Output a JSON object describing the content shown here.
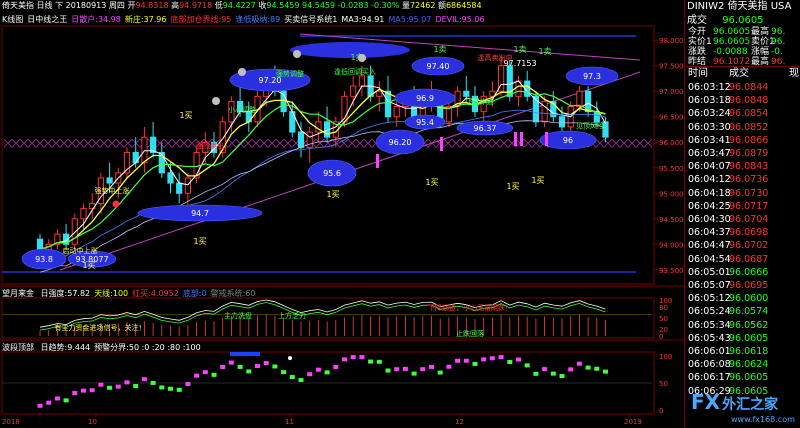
{
  "header": {
    "name": "倚天美指",
    "period": "日线",
    "direction": "下",
    "date": "20180913",
    "weekday": "周四",
    "open_label": "开",
    "open": "94.8318",
    "high_label": "高",
    "high": "94.9718",
    "low_label": "低",
    "low": "94.4227",
    "close_label": "收",
    "close": "94.5459",
    "ref": "94.5459",
    "change": "-0.0283",
    "pct": "-0.30%",
    "vol_label": "量",
    "vol": "72462",
    "amt_label": "额",
    "amt": "6864584"
  },
  "indicator_line": {
    "items": [
      {
        "text": "K线图",
        "color": "#ffffff"
      },
      {
        "text": "日中线之王",
        "color": "#ffffff"
      },
      {
        "text": "日散户:34.98",
        "color": "#ff40ff"
      },
      {
        "text": "新庄:37.96",
        "color": "#ffff00"
      },
      {
        "text": "底部加仓界线:95",
        "color": "#ff3030"
      },
      {
        "text": "逢低吸纳:89",
        "color": "#4080ff"
      },
      {
        "text": "买卖信号系统1",
        "color": "#ffffff"
      },
      {
        "text": "MA3:94.91",
        "color": "#ffffff"
      },
      {
        "text": "MA5:95.07",
        "color": "#4060ff"
      },
      {
        "text": "DEVIL:95.06",
        "color": "#ff40ff"
      }
    ]
  },
  "main_axis": {
    "labels": [
      "98.000",
      "97.500",
      "97.000",
      "96.500",
      "96.000",
      "95.500",
      "95.000",
      "94.500",
      "94.000",
      "93.500"
    ],
    "min": 93.3,
    "max": 98.2
  },
  "annotations": {
    "ovals": [
      "97.20",
      "97.40",
      "97.3",
      "96.9",
      "95.4",
      "96.37",
      "96.20",
      "96",
      "95.6",
      "94.7",
      "93.8",
      "93.8077"
    ],
    "peak": "97.7153",
    "buy_marks": [
      "1买",
      "1买",
      "1买",
      "1买",
      "1买",
      "1买",
      "1买"
    ],
    "sell_marks": [
      "1卖",
      "1卖",
      "1卖",
      "1卖"
    ],
    "texts": [
      "下降中途",
      "强势中上涨",
      "启动中上涨",
      "小心调整",
      "强势调整",
      "强烈卖出",
      "见顶风险",
      "逢低回调买入",
      "逢高卖出中"
    ]
  },
  "panel2": {
    "title": "望月来金",
    "items": [
      {
        "text": "日强度:57.82",
        "color": "#ffffff"
      },
      {
        "text": "天线:100",
        "color": "#ffff00"
      },
      {
        "text": "红买:4.0952",
        "color": "#ff3030"
      },
      {
        "text": "底部:0",
        "color": "#4080ff"
      },
      {
        "text": "警戒系统:60",
        "color": "#808080"
      }
    ],
    "axis": [
      "100",
      "80",
      "50",
      "20",
      "0"
    ],
    "texts": [
      "下降通道，小心无量阴跌！",
      "主力洗盘",
      "上方乏力",
      "有主力资金进场信号，关注！",
      "止跌回落"
    ]
  },
  "panel3": {
    "title": "波段顶部",
    "items": [
      {
        "text": "日趋势:9.444",
        "color": "#ffffff"
      },
      {
        "text": "预警分界:50 :0 :20 :80 :100",
        "color": "#ffffff"
      }
    ],
    "axis": [
      "100",
      "50",
      "0"
    ]
  },
  "x_axis": {
    "labels": [
      "2018",
      "10",
      "11",
      "12",
      "2019"
    ]
  },
  "chart_data": {
    "type": "candlestick",
    "candles": [
      [
        94.1,
        94.2,
        93.7,
        93.9
      ],
      [
        93.9,
        94.1,
        93.6,
        94.0
      ],
      [
        94.0,
        94.3,
        93.9,
        94.2
      ],
      [
        94.2,
        94.4,
        93.9,
        94.0
      ],
      [
        94.0,
        94.6,
        93.9,
        94.5
      ],
      [
        94.5,
        94.8,
        94.3,
        94.7
      ],
      [
        94.7,
        95.0,
        94.5,
        94.8
      ],
      [
        94.8,
        95.4,
        94.6,
        95.3
      ],
      [
        95.3,
        95.6,
        95.0,
        95.2
      ],
      [
        95.2,
        95.5,
        94.9,
        95.4
      ],
      [
        95.4,
        95.9,
        95.3,
        95.8
      ],
      [
        95.8,
        96.1,
        95.5,
        95.6
      ],
      [
        95.6,
        96.3,
        95.4,
        96.1
      ],
      [
        96.1,
        96.4,
        95.7,
        95.8
      ],
      [
        95.8,
        96.0,
        95.3,
        95.4
      ],
      [
        95.4,
        95.6,
        95.0,
        95.2
      ],
      [
        95.2,
        95.4,
        94.8,
        95.0
      ],
      [
        95.0,
        95.4,
        94.7,
        95.3
      ],
      [
        95.3,
        95.9,
        95.2,
        95.8
      ],
      [
        95.8,
        96.2,
        95.6,
        96.0
      ],
      [
        96.0,
        96.2,
        95.7,
        95.8
      ],
      [
        95.8,
        96.5,
        95.7,
        96.4
      ],
      [
        96.4,
        96.9,
        96.2,
        96.8
      ],
      [
        96.8,
        97.1,
        96.5,
        96.6
      ],
      [
        96.6,
        96.8,
        96.2,
        96.4
      ],
      [
        96.4,
        97.0,
        96.3,
        96.9
      ],
      [
        96.9,
        97.4,
        96.7,
        97.2
      ],
      [
        97.2,
        97.5,
        96.9,
        97.0
      ],
      [
        97.0,
        97.2,
        96.5,
        96.6
      ],
      [
        96.6,
        96.8,
        96.1,
        96.2
      ],
      [
        96.2,
        96.4,
        95.7,
        95.9
      ],
      [
        95.9,
        96.3,
        95.6,
        96.2
      ],
      [
        96.2,
        96.6,
        96.0,
        96.4
      ],
      [
        96.4,
        96.7,
        96.0,
        96.1
      ],
      [
        96.1,
        96.5,
        95.9,
        96.4
      ],
      [
        96.4,
        97.0,
        96.3,
        96.9
      ],
      [
        96.9,
        97.3,
        96.7,
        97.1
      ],
      [
        97.1,
        97.5,
        96.9,
        97.3
      ],
      [
        97.3,
        97.5,
        96.8,
        96.9
      ],
      [
        96.9,
        97.2,
        96.6,
        97.0
      ],
      [
        97.0,
        97.3,
        96.4,
        96.5
      ],
      [
        96.5,
        96.8,
        96.3,
        96.7
      ],
      [
        96.7,
        97.0,
        96.5,
        96.8
      ],
      [
        96.8,
        97.1,
        96.4,
        96.5
      ],
      [
        96.5,
        96.9,
        96.3,
        96.8
      ],
      [
        96.8,
        97.2,
        96.6,
        96.9
      ],
      [
        96.9,
        97.0,
        96.3,
        96.4
      ],
      [
        96.4,
        96.8,
        96.3,
        96.7
      ],
      [
        96.7,
        97.1,
        96.5,
        97.0
      ],
      [
        97.0,
        97.3,
        96.8,
        96.9
      ],
      [
        96.9,
        97.1,
        96.5,
        96.6
      ],
      [
        96.6,
        97.0,
        96.4,
        96.9
      ],
      [
        96.9,
        97.2,
        96.7,
        97.0
      ],
      [
        97.0,
        97.7,
        96.9,
        97.5
      ],
      [
        97.5,
        97.6,
        96.8,
        96.9
      ],
      [
        96.9,
        97.3,
        96.7,
        97.2
      ],
      [
        97.2,
        97.4,
        96.8,
        96.9
      ],
      [
        96.9,
        97.0,
        96.3,
        96.4
      ],
      [
        96.4,
        96.9,
        96.3,
        96.8
      ],
      [
        96.8,
        97.0,
        96.4,
        96.5
      ],
      [
        96.5,
        96.7,
        96.1,
        96.3
      ],
      [
        96.3,
        96.8,
        96.2,
        96.7
      ],
      [
        96.7,
        97.1,
        96.6,
        97.0
      ],
      [
        97.0,
        97.1,
        96.5,
        96.6
      ],
      [
        96.6,
        96.8,
        96.3,
        96.4
      ],
      [
        96.4,
        96.5,
        96.0,
        96.1
      ]
    ]
  },
  "right": {
    "title": "成交",
    "title_price": "96.0605",
    "quote": [
      {
        "k": "今开",
        "v": "96.0605",
        "k2": "最高",
        "v2": "96.",
        "c": "g"
      },
      {
        "k": "实价1",
        "v": "96.0605",
        "k2": "卖价1",
        "v2": "96.",
        "c": "g"
      },
      {
        "k": "涨跌",
        "v": "-0.0088",
        "k2": "涨幅",
        "v2": "-0.",
        "c": "g"
      },
      {
        "k": "昨结",
        "v": "96.1072",
        "k2": "最高",
        "v2": "96.",
        "c": "r"
      }
    ],
    "list_header": {
      "time": "时间",
      "price": "成交",
      "extra": "现"
    },
    "ticks": [
      {
        "t": "06:03:12",
        "p": "96.0844",
        "c": "r"
      },
      {
        "t": "06:03:18",
        "p": "96.0848",
        "c": "r"
      },
      {
        "t": "06:03:24",
        "p": "96.0854",
        "c": "r"
      },
      {
        "t": "06:03:30",
        "p": "96.0852",
        "c": "r"
      },
      {
        "t": "06:03:41",
        "p": "96.0866",
        "c": "r"
      },
      {
        "t": "06:03:47",
        "p": "96.0879",
        "c": "r"
      },
      {
        "t": "06:04:07",
        "p": "96.0843",
        "c": "r"
      },
      {
        "t": "06:04:12",
        "p": "96.0736",
        "c": "r"
      },
      {
        "t": "06:04:18",
        "p": "96.0730",
        "c": "r"
      },
      {
        "t": "06:04:25",
        "p": "96.0717",
        "c": "r"
      },
      {
        "t": "06:04:30",
        "p": "96.0704",
        "c": "r"
      },
      {
        "t": "06:04:37",
        "p": "96.0698",
        "c": "r"
      },
      {
        "t": "06:04:47",
        "p": "96.0702",
        "c": "r"
      },
      {
        "t": "06:04:54",
        "p": "96.0687",
        "c": "r"
      },
      {
        "t": "06:05:01",
        "p": "96.0666",
        "c": "g"
      },
      {
        "t": "06:05:07",
        "p": "96.0695",
        "c": "r"
      },
      {
        "t": "06:05:12",
        "p": "96.0600",
        "c": "g"
      },
      {
        "t": "06:05:24",
        "p": "96.0574",
        "c": "g"
      },
      {
        "t": "06:05:34",
        "p": "96.0562",
        "c": "g"
      },
      {
        "t": "06:05:43",
        "p": "96.0605",
        "c": "g"
      },
      {
        "t": "06:06:01",
        "p": "96.0618",
        "c": "g"
      },
      {
        "t": "06:06:08",
        "p": "96.0624",
        "c": "g"
      },
      {
        "t": "06:06:17",
        "p": "96.0605",
        "c": "g"
      },
      {
        "t": "06:06:29",
        "p": "96.0605",
        "c": "g"
      }
    ],
    "top": {
      "code": "DINIW2",
      "name": "倚天美指",
      "region": "USA"
    }
  },
  "watermark": {
    "text": "外汇之家",
    "url": "www.fx168.com"
  }
}
